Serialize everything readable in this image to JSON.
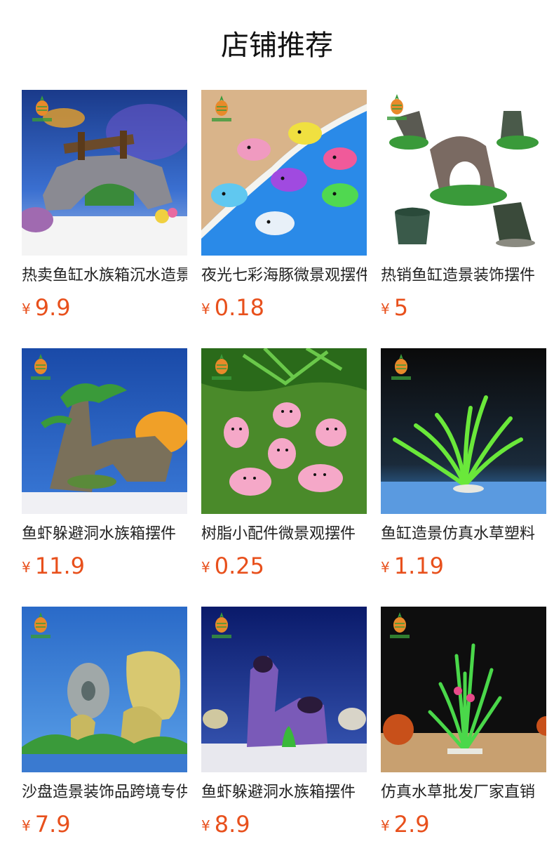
{
  "page": {
    "title": "店铺推荐"
  },
  "products": [
    {
      "name": "热卖鱼缸水族箱沉水造景",
      "currency": "¥",
      "price": "9.9",
      "image": "aquarium-rock-bridge-ornament"
    },
    {
      "name": "夜光七彩海豚微景观摆件",
      "currency": "¥",
      "price": "0.18",
      "image": "glow-dolphin-figurines"
    },
    {
      "name": "热销鱼缸造景装饰摆件",
      "currency": "¥",
      "price": "5",
      "image": "ancient-vase-ornaments"
    },
    {
      "name": "鱼虾躲避洞水族箱摆件",
      "currency": "¥",
      "price": "11.9",
      "image": "rock-tree-cave"
    },
    {
      "name": "树脂小配件微景观摆件",
      "currency": "¥",
      "price": "0.25",
      "image": "glow-pig-figurines"
    },
    {
      "name": "鱼缸造景仿真水草塑料",
      "currency": "¥",
      "price": "1.19",
      "image": "artificial-fern-plant"
    },
    {
      "name": "沙盘造景装饰品跨境专供",
      "currency": "¥",
      "price": "7.9",
      "image": "yellow-rock-stones"
    },
    {
      "name": "鱼虾躲避洞水族箱摆件",
      "currency": "¥",
      "price": "8.9",
      "image": "purple-ruins-cave"
    },
    {
      "name": "仿真水草批发厂家直销",
      "currency": "¥",
      "price": "2.9",
      "image": "artificial-grass-plant"
    }
  ],
  "colors": {
    "price": "#e8501c",
    "text": "#222222"
  }
}
